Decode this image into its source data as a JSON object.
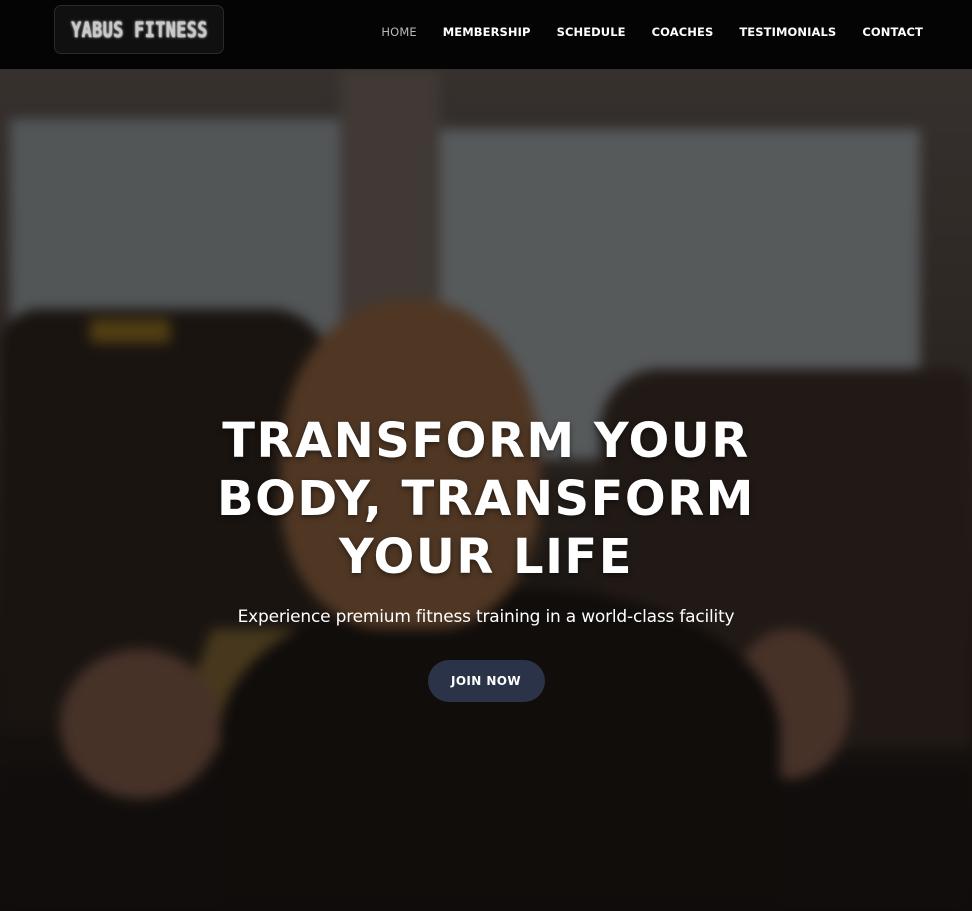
{
  "brand": {
    "logo_text": "YABUS FITNESS"
  },
  "nav": {
    "items": [
      {
        "label": "HOME",
        "active": true
      },
      {
        "label": "MEMBERSHIP",
        "active": false
      },
      {
        "label": "SCHEDULE",
        "active": false
      },
      {
        "label": "COACHES",
        "active": false
      },
      {
        "label": "TESTIMONIALS",
        "active": false
      },
      {
        "label": "CONTACT",
        "active": false
      }
    ]
  },
  "hero": {
    "title": "TRANSFORM YOUR BODY, TRANSFORM YOUR LIFE",
    "subtitle": "Experience premium fitness training in a world-class facility",
    "cta_label": "JOIN NOW"
  },
  "colors": {
    "navbar_bg": "#040404",
    "cta_bg": "#2a3347",
    "active_nav": "#b9b9b9"
  }
}
